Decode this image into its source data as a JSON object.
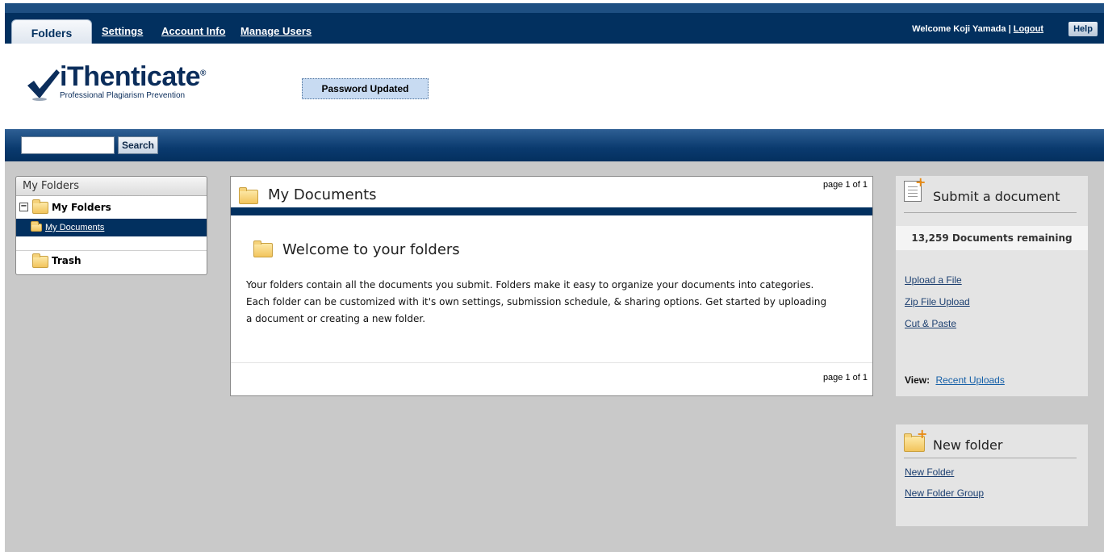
{
  "nav": {
    "tabs": [
      "Folders",
      "Settings",
      "Account Info",
      "Manage Users"
    ],
    "welcome": "Welcome Koji Yamada",
    "separator": "|",
    "logout": "Logout",
    "help": "Help"
  },
  "header": {
    "logo_name": "iThenticate",
    "logo_reg": "®",
    "logo_tagline": "Professional Plagiarism Prevention",
    "flash_message": "Password Updated"
  },
  "search": {
    "value": "",
    "button": "Search"
  },
  "sidebar": {
    "title": "My Folders",
    "group": "My Folders",
    "items": [
      "My Documents",
      "Trash"
    ]
  },
  "main": {
    "title": "My Documents",
    "pager_top": "page 1 of 1",
    "welcome_title": "Welcome to your folders",
    "body_lines": [
      "Your folders contain all the documents you submit. Folders make it easy to organize your documents into categories.",
      "Each folder can be customized with it's own settings, submission schedule, & sharing options. Get started by uploading",
      "a document or creating a new folder."
    ],
    "pager_bottom": "page 1 of 1"
  },
  "submit": {
    "title": "Submit a document",
    "remaining": "13,259 Documents remaining",
    "links": [
      "Upload a File",
      "Zip File Upload",
      "Cut & Paste"
    ],
    "view_label": "View:",
    "view_link": "Recent Uploads"
  },
  "new_folder": {
    "title": "New folder",
    "links": [
      "New Folder",
      "New Folder Group"
    ]
  },
  "colors": {
    "nav_bg": "#02305f",
    "accent": "#1c3f70",
    "page_bg": "#c9c9c9"
  }
}
